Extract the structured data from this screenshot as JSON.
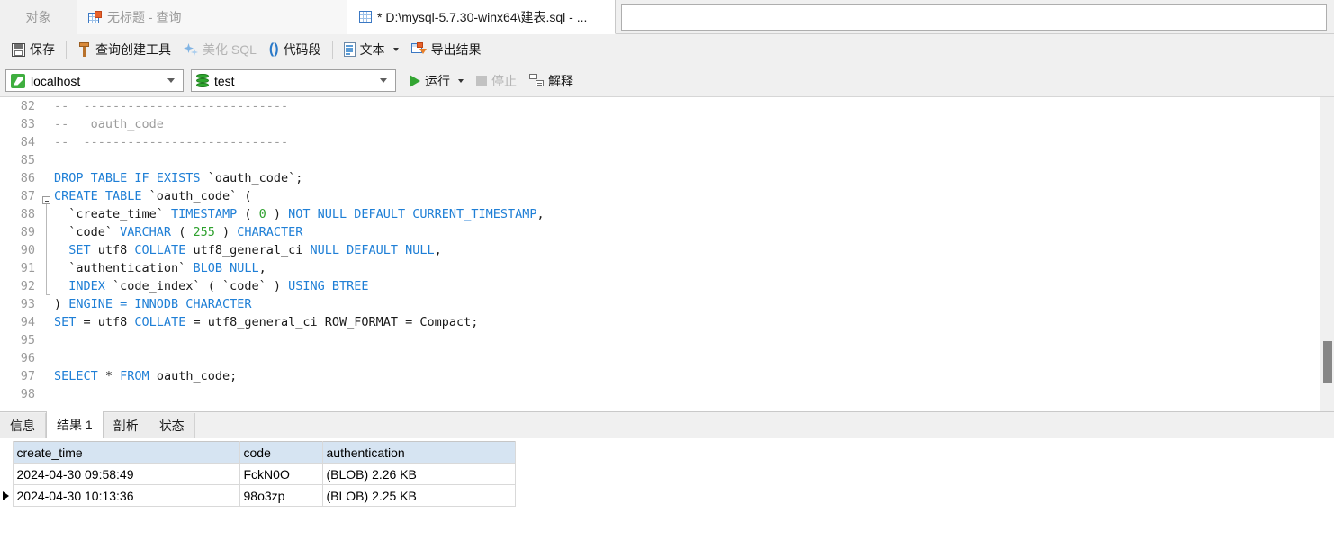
{
  "tabstrip": {
    "object_tab": "对象",
    "query_tab": {
      "label": "无标题 - 查询",
      "icon": "table-query-icon"
    },
    "file_tab": {
      "label": "* D:\\mysql-5.7.30-winx64\\建表.sql - ...",
      "icon": "table-file-icon"
    }
  },
  "toolbar": {
    "save": "保存",
    "query_builder": "查询创建工具",
    "beautify_sql": "美化 SQL",
    "code_snippet": "代码段",
    "text": "文本",
    "export_result": "导出结果"
  },
  "connbar": {
    "host": "localhost",
    "database": "test",
    "run": "运行",
    "stop": "停止",
    "explain": "解释"
  },
  "editor": {
    "first_line_number": 82,
    "lines": [
      {
        "n": 82,
        "tokens": [
          {
            "t": "--  ----------------------------",
            "c": "cmt"
          }
        ]
      },
      {
        "n": 83,
        "tokens": [
          {
            "t": "--   oauth_code",
            "c": "cmt"
          }
        ]
      },
      {
        "n": 84,
        "tokens": [
          {
            "t": "--  ----------------------------",
            "c": "cmt"
          }
        ]
      },
      {
        "n": 85,
        "tokens": []
      },
      {
        "n": 86,
        "tokens": [
          {
            "t": "DROP TABLE IF EXISTS ",
            "c": "kw"
          },
          {
            "t": "`oauth_code`;",
            "c": "pln"
          }
        ]
      },
      {
        "n": 87,
        "tokens": [
          {
            "t": "CREATE TABLE ",
            "c": "kw"
          },
          {
            "t": "`oauth_code` (",
            "c": "pln"
          }
        ]
      },
      {
        "n": 88,
        "tokens": [
          {
            "t": "  `create_time` ",
            "c": "pln"
          },
          {
            "t": "TIMESTAMP ",
            "c": "kw"
          },
          {
            "t": "( ",
            "c": "pln"
          },
          {
            "t": "0",
            "c": "num"
          },
          {
            "t": " ) ",
            "c": "pln"
          },
          {
            "t": "NOT NULL DEFAULT CURRENT_TIMESTAMP",
            "c": "kw"
          },
          {
            "t": ",",
            "c": "pln"
          }
        ]
      },
      {
        "n": 89,
        "tokens": [
          {
            "t": "  `code` ",
            "c": "pln"
          },
          {
            "t": "VARCHAR ",
            "c": "kw"
          },
          {
            "t": "( ",
            "c": "pln"
          },
          {
            "t": "255",
            "c": "num"
          },
          {
            "t": " ) ",
            "c": "pln"
          },
          {
            "t": "CHARACTER",
            "c": "kw"
          }
        ]
      },
      {
        "n": 90,
        "tokens": [
          {
            "t": "  SET ",
            "c": "kw"
          },
          {
            "t": "COLLATE ",
            "c": "kw"
          },
          {
            "t": "utf8_general_ci ",
            "c": "pln"
          },
          {
            "t": "NULL DEFAULT NULL",
            "c": "kw"
          },
          {
            "t": ",",
            "c": "pln"
          }
        ]
      },
      {
        "n": 91,
        "tokens": [
          {
            "t": "  `authentication` ",
            "c": "pln"
          },
          {
            "t": "BLOB NULL",
            "c": "kw"
          },
          {
            "t": ",",
            "c": "pln"
          }
        ]
      },
      {
        "n": 92,
        "tokens": [
          {
            "t": "  INDEX ",
            "c": "kw"
          },
          {
            "t": "`code_index` ( `code` ) ",
            "c": "pln"
          },
          {
            "t": "USING BTREE",
            "c": "kw"
          }
        ]
      },
      {
        "n": 93,
        "tokens": [
          {
            "t": ") ",
            "c": "pln"
          },
          {
            "t": "ENGINE = INNODB CHARACTER",
            "c": "kw"
          }
        ]
      },
      {
        "n": 94,
        "tokens": [
          {
            "t": "SET ",
            "c": "kw"
          },
          {
            "t": "= utf8 ",
            "c": "pln"
          },
          {
            "t": "COLLATE ",
            "c": "kw"
          },
          {
            "t": "= utf8_general_ci ROW_FORMAT = Compact;",
            "c": "pln"
          }
        ]
      },
      {
        "n": 95,
        "tokens": []
      },
      {
        "n": 96,
        "tokens": []
      },
      {
        "n": 97,
        "tokens": [
          {
            "t": "SELECT ",
            "c": "kw"
          },
          {
            "t": "* ",
            "c": "pln"
          },
          {
            "t": "FROM ",
            "c": "kw"
          },
          {
            "t": "oauth_code;",
            "c": "pln"
          }
        ]
      },
      {
        "n": 98,
        "tokens": []
      }
    ],
    "raw_lines": [
      "--  ----------------------------",
      "--   oauth_code",
      "--  ----------------------------",
      "",
      "DROP TABLE IF EXISTS `oauth_code`;",
      "CREATE TABLE `oauth_code` (",
      "  `create_time` TIMESTAMP ( 0 ) NOT NULL DEFAULT CURRENT_TIMESTAMP,",
      "  `code` VARCHAR ( 255 ) CHARACTER",
      "  SET utf8 COLLATE utf8_general_ci NULL DEFAULT NULL,",
      "  `authentication` BLOB NULL,",
      "  INDEX `code_index` ( `code` ) USING BTREE",
      ") ENGINE = INNODB CHARACTER",
      "SET = utf8 COLLATE = utf8_general_ci ROW_FORMAT = Compact;",
      "",
      "",
      "SELECT * FROM oauth_code;",
      ""
    ]
  },
  "result_tabs": [
    {
      "label": "信息",
      "selected": false
    },
    {
      "label": "结果 1",
      "selected": true
    },
    {
      "label": "剖析",
      "selected": false
    },
    {
      "label": "状态",
      "selected": false
    }
  ],
  "result_grid": {
    "columns": [
      "create_time",
      "code",
      "authentication"
    ],
    "rows": [
      {
        "create_time": "2024-04-30 09:58:49",
        "code": "FckN0O",
        "authentication": "(BLOB) 2.26 KB",
        "current": false
      },
      {
        "create_time": "2024-04-30 10:13:36",
        "code": "98o3zp",
        "authentication": "(BLOB) 2.25 KB",
        "current": true
      }
    ]
  },
  "colors": {
    "keyword": "#1f7fd6",
    "number": "#2ea12e",
    "comment": "#9c9c9c",
    "header_bg": "#d6e4f2",
    "chrome_bg": "#f0f0f0",
    "run_green": "#33a532"
  }
}
